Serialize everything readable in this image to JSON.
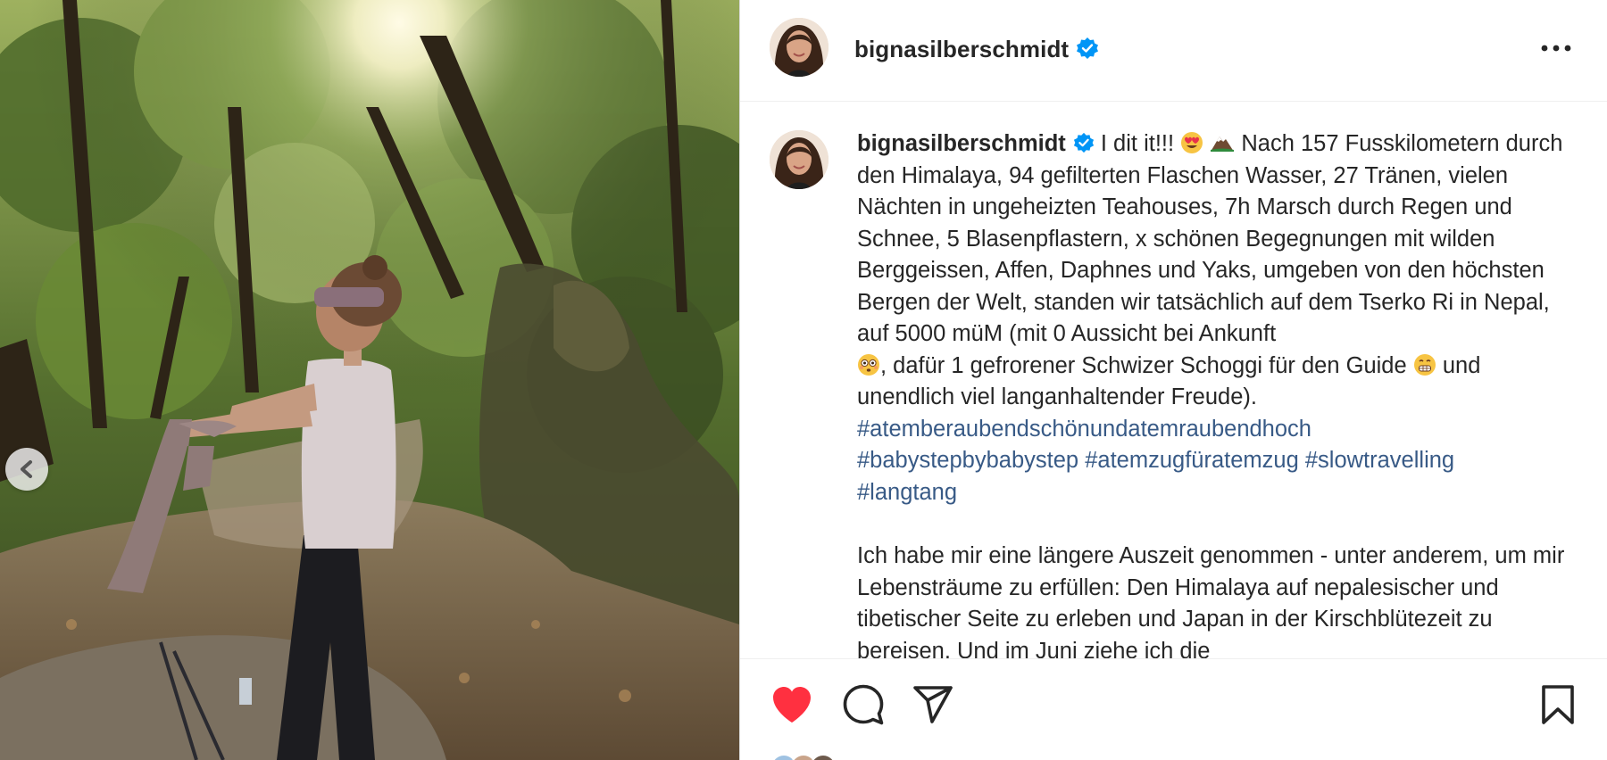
{
  "post": {
    "username": "bignasilberschmidt",
    "verified": true,
    "more_icon": "more-horizontal-icon",
    "caption": {
      "username": "bignasilberschmidt",
      "t1": "I dit it!!!",
      "t2": "Nach 157 Fusskilometern durch den Himalaya, 94 gefilterten Flaschen Wasser, 27 Tränen, vielen Nächten in ungeheizten Teahouses, 7h Marsch durch Regen und Schnee, 5 Blasenpflastern, x schönen Begegnungen mit wilden Berggeissen, Affen, Daphnes und Yaks, umgeben von den höchsten Bergen der Welt, standen wir tatsächlich auf dem Tserko Ri in Nepal, auf 5000 müM (mit 0 Aussicht bei Ankunft",
      "t3": ", dafür 1 gefrorener Schwizer Schoggi für den Guide",
      "t4": "und unendlich viel langanhaltender Freude).",
      "hashtags": [
        "#atemberaubendschönundatemraubendhoch",
        "#babystepbybabystep",
        "#atemzugfüratemzug",
        "#slowtravelling",
        "#langtang"
      ],
      "paragraph2": "Ich habe mir eine längere Auszeit genommen - unter anderem, um mir Lebensträume zu erfüllen: Den Himalaya auf nepalesischer und tibetischer Seite zu erleben und Japan in der Kirschblütezeit zu bereisen. Und im Juni ziehe ich die"
    },
    "emojis": [
      "heart-eyes-emoji",
      "mountain-emoji",
      "flushed-face-emoji",
      "grimacing-face-emoji"
    ]
  },
  "actions": {
    "like_icon": "heart-filled-icon",
    "comment_icon": "comment-icon",
    "share_icon": "paper-plane-icon",
    "save_icon": "bookmark-icon",
    "liked": true
  },
  "carousel": {
    "prev_icon": "chevron-left-icon"
  },
  "colors": {
    "like_red": "#ff3040",
    "hashtag_blue": "#385a86",
    "verified_blue": "#0095f6",
    "text": "#262626"
  }
}
